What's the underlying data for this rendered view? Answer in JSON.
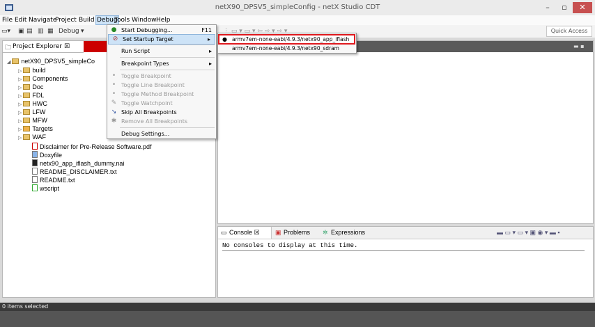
{
  "window": {
    "title": "netX90_DPSV5_simpleConfig - netX Studio CDT",
    "minimize": "–",
    "maximize": "▫",
    "close": "✕"
  },
  "menubar": {
    "items": [
      "File",
      "Edit",
      "Navigate",
      "Project",
      "Build",
      "Debug",
      "Tools",
      "Window",
      "Help"
    ]
  },
  "toolbar": {
    "debug_label": "Debug",
    "quick_access": "Quick Access"
  },
  "debug_menu": {
    "start_debugging": "Start Debugging...",
    "start_debugging_shortcut": "F11",
    "set_startup_target": "Set Startup Target",
    "run_script": "Run Script",
    "breakpoint_types": "Breakpoint Types",
    "toggle_breakpoint": "Toggle Breakpoint",
    "toggle_line_breakpoint": "Toggle Line Breakpoint",
    "toggle_method_breakpoint": "Toggle Method Breakpoint",
    "toggle_watchpoint": "Toggle Watchpoint",
    "skip_all_breakpoints": "Skip All Breakpoints",
    "remove_all_breakpoints": "Remove All Breakpoints",
    "debug_settings": "Debug Settings..."
  },
  "submenu": {
    "item1": "armv7em-none-eabi/4.9.3/netx90_app_iflash",
    "item2": "armv7em-none-eabi/4.9.3/netx90_sdram"
  },
  "project_explorer": {
    "tab_label": "Project Explorer ☒",
    "project": "netX90_DPSV5_simpleCo",
    "folders": [
      "build",
      "Components",
      "Doc",
      "FDL",
      "HWC",
      "LFW",
      "MFW",
      "Targets",
      "WAF"
    ],
    "files": [
      "Disclaimer for Pre-Release Software.pdf",
      "Doxyfile",
      "netx90_app_iflash_dummy.nai",
      "README_DISCLAIMER.txt",
      "README.txt",
      "wscript"
    ]
  },
  "console": {
    "tabs": [
      "Console ☒",
      "Problems",
      "Expressions"
    ],
    "message": "No consoles to display at this time."
  },
  "status": {
    "text": "0 items selected"
  },
  "colors": {
    "highlight": "#cde3f7",
    "red_box": "#e0191e",
    "close_btn": "#c75050"
  }
}
